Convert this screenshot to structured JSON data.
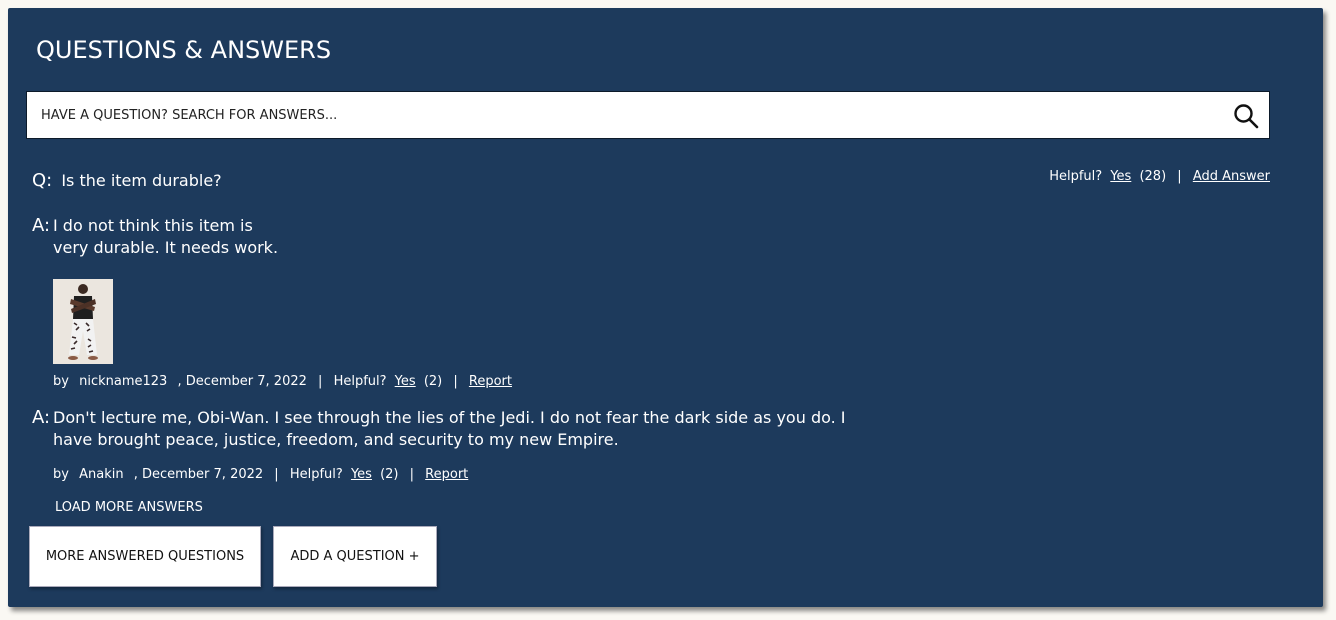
{
  "header": {
    "title": "QUESTIONS & ANSWERS"
  },
  "search": {
    "placeholder": "HAVE A QUESTION? SEARCH FOR ANSWERS..."
  },
  "question": {
    "prefix": "Q:",
    "text": "Is the item durable?",
    "helpful_label": "Helpful?",
    "yes_label": "Yes",
    "count": "(28)",
    "separator": "|",
    "add_answer_label": "Add Answer"
  },
  "answers": [
    {
      "prefix": "A:",
      "text": "I do not think this item is very durable. It needs work.",
      "has_photo": true,
      "by_label": "by",
      "author": "nickname123",
      "date": ", December 7, 2022",
      "separator": "|",
      "helpful_label": "Helpful?",
      "yes_label": "Yes",
      "count": "(2)",
      "report_label": "Report"
    },
    {
      "prefix": "A:",
      "text": "Don't lecture me, Obi-Wan. I see through the lies of the Jedi. I do not fear the dark side as you do. I have brought peace, justice, freedom, and security to my new Empire.",
      "has_photo": false,
      "by_label": "by",
      "author": "Anakin",
      "date": ", December 7, 2022",
      "separator": "|",
      "helpful_label": "Helpful?",
      "yes_label": "Yes",
      "count": "(2)",
      "report_label": "Report"
    }
  ],
  "load_more_label": "LOAD MORE ANSWERS",
  "buttons": {
    "more_questions": "MORE ANSWERED QUESTIONS",
    "add_question": "ADD A QUESTION +"
  },
  "colors": {
    "panel_bg": "#1d3a5c",
    "text": "#ffffff",
    "button_bg": "#ffffff"
  },
  "icons": {
    "search": "search-icon"
  }
}
